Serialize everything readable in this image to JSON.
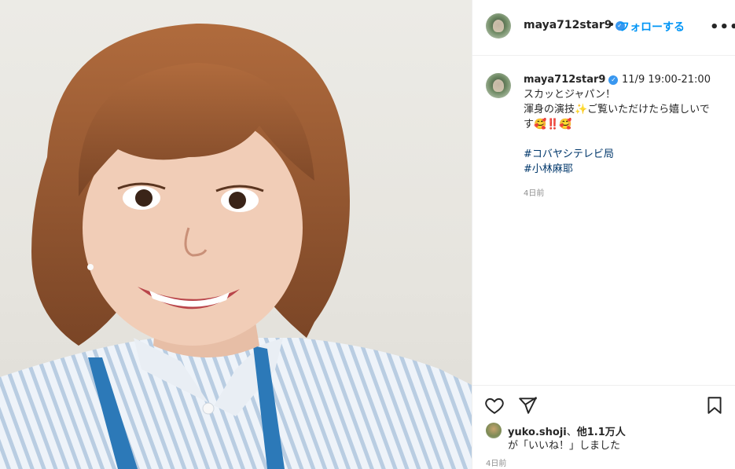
{
  "post": {
    "username": "maya712star9",
    "verified_mark": "✓",
    "separator": "•",
    "follow_label": "フォローする",
    "more_label": "•••",
    "caption_lines": [
      "11/9 19:00-21:00スカッとジャパン！",
      "渾身の演技✨ご覧いただけたら嬉しいです🥰‼️🥰"
    ],
    "hashtags": [
      "#コバヤシテレビ局",
      "#小林麻耶"
    ],
    "caption_time": "4日前",
    "likes_user": "yuko.shoji",
    "likes_joiner": "、",
    "likes_others": "他1.1万人",
    "likes_suffix": "が「いいね！」しました",
    "post_time": "4日前"
  },
  "icons": {
    "avatar": "profile-avatar",
    "heart": "heart-icon",
    "share": "paper-plane-icon",
    "bookmark": "bookmark-icon",
    "more": "more-options-icon"
  },
  "colors": {
    "follow_blue": "#0095f6",
    "verified_blue": "#3897f0",
    "hashtag_blue": "#00376b",
    "muted": "#8e8e8e"
  }
}
